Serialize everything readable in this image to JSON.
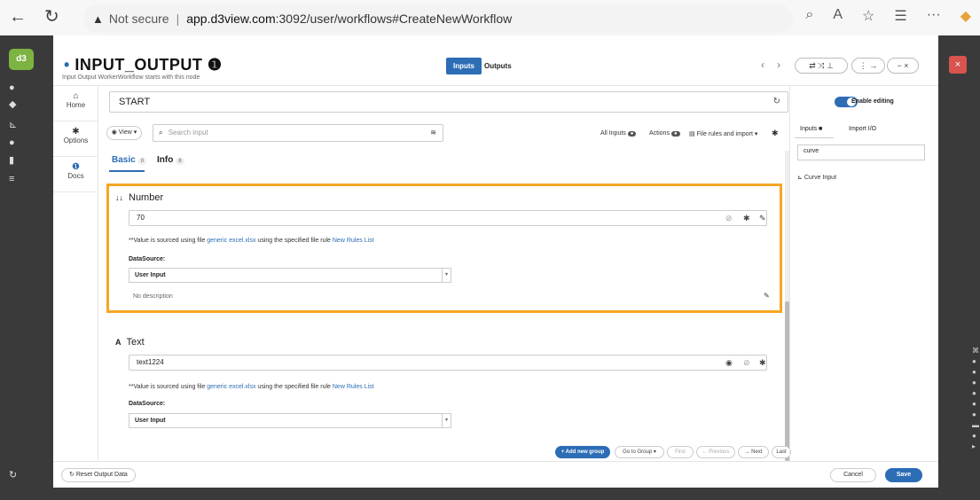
{
  "browser": {
    "back": "←",
    "reload": "↻",
    "security": "Not secure",
    "url_host": "app.d3view.com",
    "url_rest": ":3092/user/workflows#CreateNewWorkflow"
  },
  "modal": {
    "title": "INPUT_OUTPUT",
    "subtitle": "Input Output WorkerWorkflow starts with this node",
    "tab_inputs": "Inputs",
    "tab_outputs": "Outputs"
  },
  "left_nav": [
    {
      "icon": "home-icon",
      "label": "Home"
    },
    {
      "icon": "gear-icon",
      "label": "Options"
    },
    {
      "icon": "info-icon",
      "label": "Docs"
    }
  ],
  "start_field": {
    "value": "START"
  },
  "toolbar": {
    "view_label": "View",
    "search_placeholder": "Search input",
    "all_inputs": "All Inputs",
    "actions": "Actions",
    "file_rules": "File rules and import"
  },
  "subtabs": [
    {
      "label": "Basic",
      "count": "0"
    },
    {
      "label": "Info",
      "count": "6"
    }
  ],
  "cards": [
    {
      "title": "Number",
      "value": "70",
      "note_prefix": "**Value is sourced using file",
      "note_file": "generic excel.xlsx",
      "note_mid": "using the specified file rule",
      "note_rule": "New Rules List",
      "datasource_label": "DataSource:",
      "datasource_value": "User Input",
      "description": "No description"
    },
    {
      "title": "Text",
      "value": "text1224",
      "note_prefix": "**Value is sourced using file",
      "note_file": "generic excel.xlsx",
      "note_mid": "using the specified file rule",
      "note_rule": "New Rules List",
      "datasource_label": "DataSource:",
      "datasource_value": "User Input"
    }
  ],
  "bottom_nav": {
    "add_group": "+ Add new group",
    "go_to_group": "Go to Group ▾",
    "first": "First",
    "previous": "← Previous",
    "next": "→ Next",
    "last": "Last"
  },
  "right_panel": {
    "toggle_label": "Enable editing",
    "tab_inputs": "Inputs",
    "tab_import": "Import I/O",
    "search_value": "curve",
    "item": "Curve Input"
  },
  "footer": {
    "reset": "Reset Output Data",
    "cancel": "Cancel",
    "save": "Save"
  },
  "colors": {
    "accent": "#2c6db5",
    "highlight": "#f5a623",
    "dark_bg": "#3a3a3a",
    "danger": "#d9534f"
  }
}
